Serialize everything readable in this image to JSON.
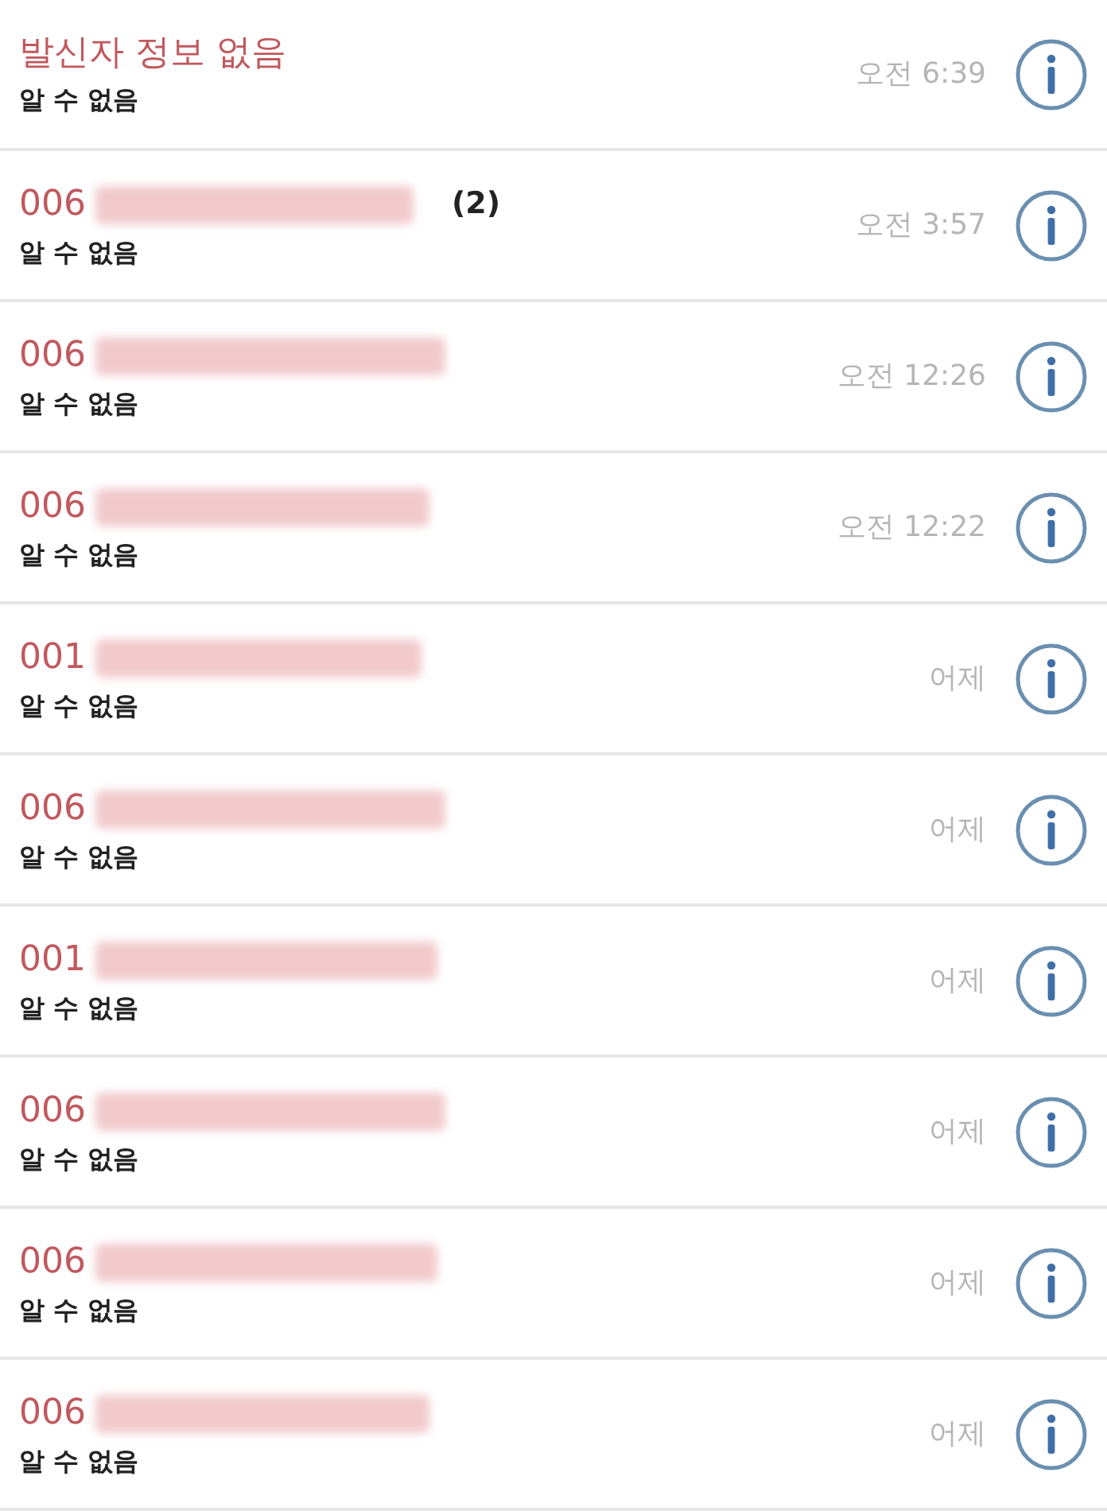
{
  "calls": [
    {
      "name": "발신자 정보 없음",
      "missed": true,
      "redacted": false,
      "label": "알 수 없음",
      "time": "오전 6:39"
    },
    {
      "name": "006",
      "missed": true,
      "redacted": true,
      "count": "(2)",
      "label": "알 수 없음",
      "time": "오전 3:57"
    },
    {
      "name": "006",
      "missed": true,
      "redacted": true,
      "label": "알 수 없음",
      "time": "오전 12:26"
    },
    {
      "name": "006",
      "missed": true,
      "redacted": true,
      "label": "알 수 없음",
      "time": "오전 12:22"
    },
    {
      "name": "001",
      "missed": true,
      "redacted": true,
      "label": "알 수 없음",
      "time": "어제"
    },
    {
      "name": "006",
      "missed": true,
      "redacted": true,
      "label": "알 수 없음",
      "time": "어제"
    },
    {
      "name": "001",
      "missed": true,
      "redacted": true,
      "label": "알 수 없음",
      "time": "어제"
    },
    {
      "name": "006",
      "missed": true,
      "redacted": true,
      "label": "알 수 없음",
      "time": "어제"
    },
    {
      "name": "006",
      "missed": true,
      "redacted": true,
      "label": "알 수 없음",
      "time": "어제"
    },
    {
      "name": "006",
      "missed": true,
      "redacted": true,
      "label": "알 수 없음",
      "time": "어제"
    }
  ]
}
